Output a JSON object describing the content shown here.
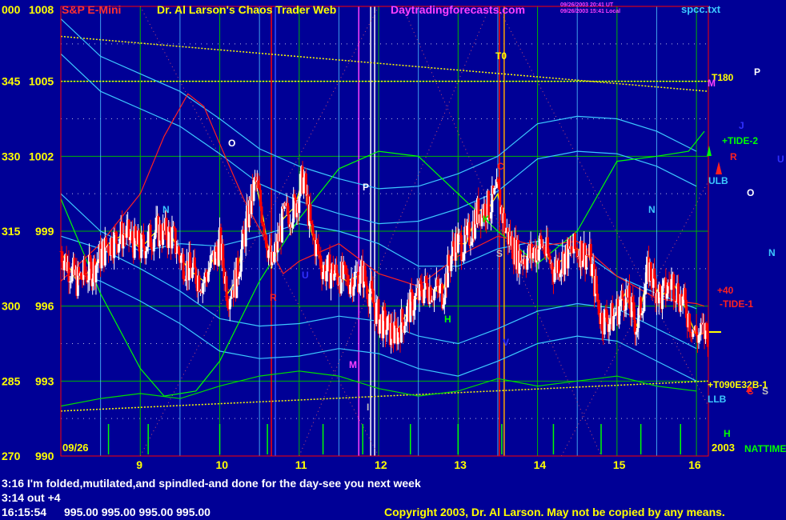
{
  "header": {
    "left_axis_top": "000",
    "price_top": "1008",
    "symbol": "S&P E-Mini",
    "site_title": "Dr. Al Larson's Chaos Trader Web",
    "site_url": "Daytradingforecasts.com",
    "stamp_1": "09/26/2003 20:41 UT",
    "stamp_2": "09/26/2003 15:41 Local",
    "file": "spcc.txt"
  },
  "y_axis": {
    "rows": [
      {
        "deg": "000",
        "price": "1008"
      },
      {
        "deg": "345",
        "price": "1005"
      },
      {
        "deg": "330",
        "price": "1002"
      },
      {
        "deg": "315",
        "price": "999"
      },
      {
        "deg": "300",
        "price": "996"
      },
      {
        "deg": "285",
        "price": "993"
      },
      {
        "deg": "270",
        "price": "990"
      }
    ]
  },
  "x_axis": {
    "date": "09/26",
    "year": "2003",
    "hours": [
      "9",
      "10",
      "11",
      "12",
      "13",
      "14",
      "15",
      "16"
    ]
  },
  "right_labels": {
    "t180": "T180",
    "p": "P",
    "m": "M",
    "j": "J",
    "tide2": "+TIDE-2",
    "r": "R",
    "u": "U",
    "ulb": "ULB",
    "o": "O",
    "n": "N",
    "x40": "+40",
    "tide1": "-TIDE-1",
    "e32b": "+T090E32B-1",
    "llb": "LLB",
    "c": "C",
    "s": "S",
    "h": "H",
    "nattime": "NATTIME"
  },
  "chart_labels": {
    "t0": "T0",
    "o": "O",
    "n1": "N",
    "p": "P",
    "c": "C",
    "k": "K",
    "s": "S",
    "r": "R",
    "u": "U",
    "h": "H",
    "v": "V",
    "m": "M",
    "i": "I",
    "n2": "N"
  },
  "footer": {
    "note_1": "3:16 I'm folded,mutilated,and spindled-and done for the day-see you next week",
    "note_2": "3:14 out +4",
    "quote_time": "16:15:54",
    "quote_values": "995.00 995.00 995.00 995.00",
    "copyright": "Copyright 2003, Dr. Al Larson. May not be copied by any means."
  },
  "colors": {
    "background": "#000096",
    "plot_border": "#ff0000",
    "grid": "#00b400",
    "up_bar": "#ffffff",
    "down_bar": "#ff0000",
    "envelope": "#3cc8ff",
    "yellow": "#ffff00",
    "magenta": "#ff00ff",
    "green": "#00ff00"
  },
  "chart_data": {
    "type": "candlestick",
    "instrument": "S&P E-Mini",
    "date": "09/26/2003",
    "ylim": [
      990,
      1008
    ],
    "xlim_hours": [
      8.0,
      16.15
    ],
    "grid": true,
    "price_series_close": [
      [
        8.0,
        998.2
      ],
      [
        8.2,
        997.0
      ],
      [
        8.4,
        997.5
      ],
      [
        8.6,
        998.5
      ],
      [
        8.8,
        998.9
      ],
      [
        9.0,
        998.3
      ],
      [
        9.2,
        999.0
      ],
      [
        9.4,
        998.8
      ],
      [
        9.5,
        998.0
      ],
      [
        9.6,
        997.5
      ],
      [
        9.8,
        997.0
      ],
      [
        10.0,
        998.5
      ],
      [
        10.1,
        996.5
      ],
      [
        10.2,
        997.0
      ],
      [
        10.35,
        999.5
      ],
      [
        10.45,
        1001.0
      ],
      [
        10.55,
        999.5
      ],
      [
        10.65,
        997.5
      ],
      [
        10.8,
        999.5
      ],
      [
        10.95,
        1000.0
      ],
      [
        11.05,
        1001.2
      ],
      [
        11.15,
        999.0
      ],
      [
        11.3,
        997.5
      ],
      [
        11.45,
        997.3
      ],
      [
        11.6,
        997.0
      ],
      [
        11.8,
        997.3
      ],
      [
        12.0,
        995.5
      ],
      [
        12.2,
        994.8
      ],
      [
        12.4,
        996.0
      ],
      [
        12.6,
        996.8
      ],
      [
        12.8,
        996.5
      ],
      [
        12.95,
        998.5
      ],
      [
        13.1,
        998.5
      ],
      [
        13.25,
        999.8
      ],
      [
        13.4,
        1000.0
      ],
      [
        13.5,
        1000.5
      ],
      [
        13.6,
        999.0
      ],
      [
        13.75,
        998.0
      ],
      [
        13.9,
        998.0
      ],
      [
        14.05,
        998.5
      ],
      [
        14.2,
        997.5
      ],
      [
        14.35,
        998.0
      ],
      [
        14.5,
        998.3
      ],
      [
        14.65,
        998.0
      ],
      [
        14.8,
        995.5
      ],
      [
        14.95,
        995.5
      ],
      [
        15.1,
        996.5
      ],
      [
        15.25,
        995.2
      ],
      [
        15.4,
        997.5
      ],
      [
        15.55,
        996.3
      ],
      [
        15.7,
        997.0
      ],
      [
        15.85,
        996.0
      ],
      [
        16.0,
        994.8
      ],
      [
        16.15,
        995.0
      ]
    ],
    "channel_upper": [
      [
        8.0,
        1007.5
      ],
      [
        8.5,
        1006.0
      ],
      [
        9.0,
        1005.3
      ],
      [
        9.5,
        1004.6
      ],
      [
        10.0,
        1003.5
      ],
      [
        10.5,
        1002.3
      ],
      [
        11.0,
        1001.6
      ],
      [
        11.5,
        1001.1
      ],
      [
        12.0,
        1000.7
      ],
      [
        12.5,
        1000.8
      ],
      [
        13.0,
        1001.3
      ],
      [
        13.5,
        1002.0
      ],
      [
        14.0,
        1003.3
      ],
      [
        14.5,
        1003.6
      ],
      [
        15.0,
        1003.5
      ],
      [
        15.5,
        1003.0
      ],
      [
        16.0,
        1002.2
      ]
    ],
    "channel_lower": [
      [
        8.0,
        997.5
      ],
      [
        8.5,
        997.0
      ],
      [
        9.0,
        996.2
      ],
      [
        9.5,
        995.3
      ],
      [
        10.0,
        994.2
      ],
      [
        10.5,
        993.9
      ],
      [
        11.0,
        994.0
      ],
      [
        11.5,
        994.3
      ],
      [
        12.0,
        994.1
      ],
      [
        12.5,
        993.5
      ],
      [
        13.0,
        993.2
      ],
      [
        13.5,
        993.8
      ],
      [
        14.0,
        994.5
      ],
      [
        14.5,
        994.8
      ],
      [
        15.0,
        994.6
      ],
      [
        15.5,
        993.8
      ],
      [
        16.0,
        993.0
      ]
    ],
    "mid_line": [
      [
        8.0,
        1000.5
      ],
      [
        8.5,
        999.0
      ],
      [
        9.0,
        998.2
      ],
      [
        9.5,
        998.5
      ],
      [
        10.0,
        998.4
      ],
      [
        10.5,
        998.8
      ],
      [
        11.0,
        999.3
      ],
      [
        11.5,
        999.0
      ],
      [
        12.0,
        998.5
      ],
      [
        12.5,
        997.6
      ],
      [
        13.0,
        997.6
      ],
      [
        13.5,
        998.3
      ],
      [
        14.0,
        998.6
      ],
      [
        14.5,
        998.3
      ],
      [
        15.0,
        997.2
      ],
      [
        15.5,
        996.5
      ],
      [
        16.0,
        995.9
      ]
    ],
    "series": [
      {
        "name": "+TIDE-2",
        "line": [
          [
            8.0,
            1000.3
          ],
          [
            8.5,
            996.5
          ],
          [
            9.0,
            993.5
          ],
          [
            9.3,
            992.4
          ],
          [
            9.7,
            992.6
          ],
          [
            10.0,
            993.8
          ],
          [
            10.5,
            997.0
          ],
          [
            11.0,
            999.5
          ],
          [
            11.5,
            1001.5
          ],
          [
            12.0,
            1002.2
          ],
          [
            12.5,
            1002.0
          ],
          [
            13.0,
            1000.5
          ],
          [
            13.5,
            999.0
          ],
          [
            14.0,
            997.7
          ],
          [
            14.5,
            999.0
          ],
          [
            15.0,
            1001.8
          ],
          [
            15.5,
            1002.0
          ],
          [
            15.9,
            1002.2
          ],
          [
            16.1,
            1003.0
          ]
        ]
      },
      {
        "name": "-TIDE-1",
        "line": [
          [
            8.0,
            997.0
          ],
          [
            8.5,
            998.5
          ],
          [
            9.0,
            1000.5
          ],
          [
            9.3,
            1002.8
          ],
          [
            9.6,
            1004.5
          ],
          [
            9.8,
            1004.0
          ],
          [
            10.0,
            1002.5
          ],
          [
            10.3,
            1000.3
          ],
          [
            10.6,
            998.5
          ],
          [
            10.8,
            997.3
          ],
          [
            11.0,
            997.8
          ],
          [
            11.5,
            998.5
          ],
          [
            12.0,
            997.3
          ],
          [
            12.5,
            996.8
          ],
          [
            13.0,
            998.0
          ],
          [
            13.5,
            998.8
          ],
          [
            14.0,
            998.4
          ],
          [
            14.5,
            998.6
          ],
          [
            15.0,
            997.2
          ],
          [
            15.5,
            996.3
          ],
          [
            16.0,
            996.1
          ],
          [
            16.1,
            996.0
          ]
        ]
      },
      {
        "name": "+T090E32B-1",
        "line": [
          [
            8.0,
            992.0
          ],
          [
            8.5,
            992.3
          ],
          [
            9.0,
            992.5
          ],
          [
            9.5,
            992.3
          ],
          [
            10.0,
            992.8
          ],
          [
            10.5,
            993.2
          ],
          [
            11.0,
            993.4
          ],
          [
            11.5,
            993.2
          ],
          [
            12.0,
            992.7
          ],
          [
            12.5,
            992.4
          ],
          [
            13.0,
            992.6
          ],
          [
            13.5,
            993.1
          ],
          [
            14.0,
            992.8
          ],
          [
            14.5,
            993.0
          ],
          [
            15.0,
            993.2
          ],
          [
            15.5,
            992.8
          ],
          [
            16.0,
            992.6
          ]
        ]
      },
      {
        "name": "NATTIME",
        "spikes_at_hours": [
          8.6,
          9.1,
          10.0,
          10.6,
          11.3,
          11.8,
          12.4,
          13.0,
          13.55,
          14.2,
          14.8,
          15.3,
          15.8
        ]
      }
    ],
    "markers": [
      {
        "label": "T0",
        "hour": 13.55
      },
      {
        "label": "T180",
        "price": 1004.9
      },
      {
        "label": "+40",
        "price": 996.8
      }
    ]
  }
}
